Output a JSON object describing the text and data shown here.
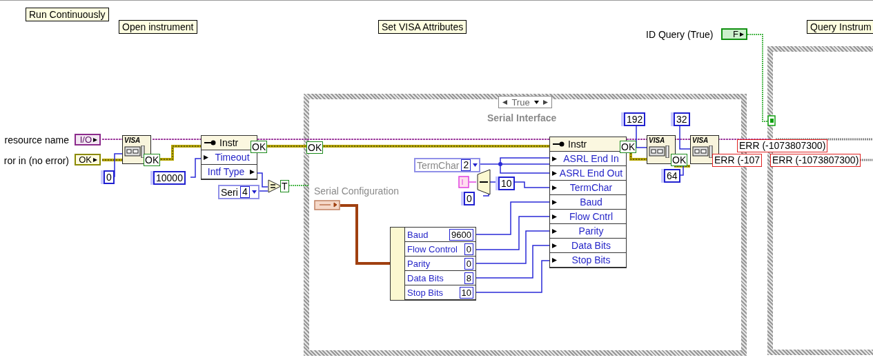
{
  "labels": [
    {
      "text": "Run Continuously"
    },
    {
      "text": "Open instrument"
    },
    {
      "text": "Set VISA Attributes"
    },
    {
      "text": "Query Instrum"
    }
  ],
  "controls": [
    {
      "kind": "resource",
      "label": "resource name",
      "value": "I/O"
    },
    {
      "kind": "error",
      "label": "ror in (no error)",
      "value": "OK"
    },
    {
      "kind": "boolean",
      "label": "ID Query (True)",
      "value": "F"
    }
  ],
  "open_node": {
    "title": "VISA",
    "output": "OK",
    "constant": "0"
  },
  "timeout_constant": "10000",
  "property_nodes": [
    {
      "title": "Instr",
      "output": "OK",
      "rows": [
        {
          "label": "Timeout",
          "kind": "input"
        },
        {
          "label": "Intf Type",
          "kind": "output"
        }
      ]
    },
    {
      "title": "Instr",
      "output": "OK",
      "rows": [
        {
          "label": "ASRL End In",
          "kind": "input"
        },
        {
          "label": "ASRL End Out",
          "kind": "input"
        },
        {
          "label": "TermChar",
          "kind": "input"
        },
        {
          "label": "Baud",
          "kind": "input"
        },
        {
          "label": "Flow Cntrl",
          "kind": "input"
        },
        {
          "label": "Parity",
          "kind": "input"
        },
        {
          "label": "Data Bits",
          "kind": "input"
        },
        {
          "label": "Stop Bits",
          "kind": "input"
        }
      ]
    }
  ],
  "interface_ring": {
    "value": "Seri",
    "index": "4"
  },
  "compare": {
    "result": "T"
  },
  "case_structure": {
    "selector": "True",
    "label": "Serial Interface",
    "input": "OK"
  },
  "termchar": {
    "label": "TermChar",
    "value": "2"
  },
  "select": {
    "true_value": "10",
    "false_value": "0"
  },
  "serial_config": {
    "label": "Serial Configuration",
    "fields": [
      {
        "name": "Baud",
        "value": "9600"
      },
      {
        "name": "Flow Control",
        "value": "0"
      },
      {
        "name": "Parity",
        "value": "0"
      },
      {
        "name": "Data Bits",
        "value": "8"
      },
      {
        "name": "Stop Bits",
        "value": "10"
      }
    ]
  },
  "buffer_nodes": [
    {
      "title": "VISA",
      "constant": "192"
    },
    {
      "title": "VISA",
      "constant": "32"
    }
  ],
  "flush_constant": "64",
  "flush_output": "OK",
  "errors": [
    "ERR (-1073807300)",
    "ERR (-107",
    "ERR (-1073807300)"
  ]
}
